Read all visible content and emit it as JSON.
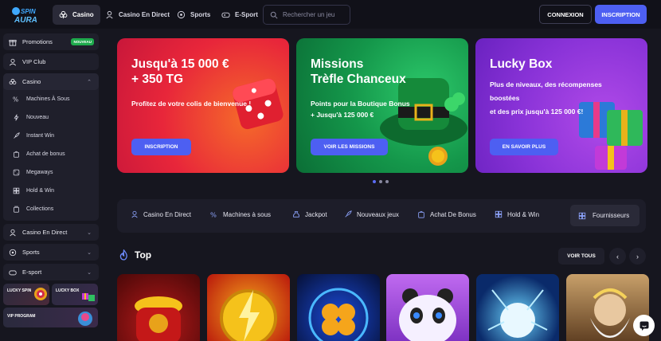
{
  "header": {
    "logo_text": "SPIN AURA",
    "tabs": [
      {
        "label": "Casino",
        "icon": "club-icon"
      },
      {
        "label": "Casino En Direct",
        "icon": "dealer-icon"
      },
      {
        "label": "Sports",
        "icon": "ball-icon"
      },
      {
        "label": "E-Sport",
        "icon": "gamepad-icon"
      }
    ],
    "search_placeholder": "Rechercher un jeu",
    "login_label": "CONNEXION",
    "register_label": "INSCRIPTION"
  },
  "sidebar": {
    "promotions": {
      "label": "Promotions",
      "badge": "NOUVEAU"
    },
    "vip": {
      "label": "VIP Club"
    },
    "casino": {
      "label": "Casino",
      "items": [
        "Machines À Sous",
        "Nouveau",
        "Instant Win",
        "Achat de bonus",
        "Megaways",
        "Hold & Win",
        "Collections"
      ]
    },
    "live": {
      "label": "Casino En Direct"
    },
    "sports": {
      "label": "Sports"
    },
    "esport": {
      "label": "E-sport"
    },
    "promo_cards": [
      "LUCKY SPIN",
      "LUCKY BOX"
    ],
    "vip_program": "VIP PROGRAM"
  },
  "banners": [
    {
      "title": "Jusqu'à 15 000 €\n+ 350 TG",
      "subtitle": "Profitez de votre colis de bienvenue !",
      "cta": "INSCRIPTION",
      "colors": {
        "from": "#e8243a",
        "to": "#f06a2a"
      }
    },
    {
      "title": "Missions\nTrèfle Chanceux",
      "subtitle_line1": "Points pour la Boutique Bonus",
      "subtitle_line2": "+ Jusqu'à 125 000 €",
      "cta": "VOIR LES MISSIONS",
      "colors": {
        "from": "#0b7a3e",
        "to": "#23b05a"
      }
    },
    {
      "title": "Lucky Box",
      "subtitle_line1": "Plus de niveaux, des récompenses",
      "subtitle_line2": "boostées",
      "subtitle_line3": "et des prix jusqu'à 125 000 €!",
      "cta": "EN SAVOIR PLUS",
      "colors": {
        "from": "#7b2fd6",
        "to": "#a24be8"
      }
    }
  ],
  "carousel_active_index": 0,
  "categories": [
    {
      "label": "Casino En Direct",
      "icon": "dealer-icon"
    },
    {
      "label": "Machines à sous",
      "icon": "slot-icon"
    },
    {
      "label": "Jackpot",
      "icon": "moneybag-icon"
    },
    {
      "label": "Nouveaux jeux",
      "icon": "rocket-icon"
    },
    {
      "label": "Achat De Bonus",
      "icon": "cart-icon"
    },
    {
      "label": "Hold & Win",
      "icon": "grid-icon"
    }
  ],
  "providers_label": "Fournisseurs",
  "top_section": {
    "title": "Top",
    "see_all": "VOIR TOUS"
  },
  "games": [
    {
      "name": "fortune-pot",
      "colors": [
        "#7a1010",
        "#d4a21a"
      ]
    },
    {
      "name": "lightning-coins",
      "colors": [
        "#b8160c",
        "#f5c21b"
      ]
    },
    {
      "name": "clover-blue",
      "colors": [
        "#0b1e5c",
        "#f5a51b"
      ]
    },
    {
      "name": "panda",
      "colors": [
        "#8d3bc8",
        "#f0e5ff"
      ]
    },
    {
      "name": "lightning-blue",
      "colors": [
        "#09245c",
        "#6dd6ff"
      ]
    },
    {
      "name": "zeus",
      "colors": [
        "#5a3a1e",
        "#e8c07a"
      ]
    }
  ]
}
